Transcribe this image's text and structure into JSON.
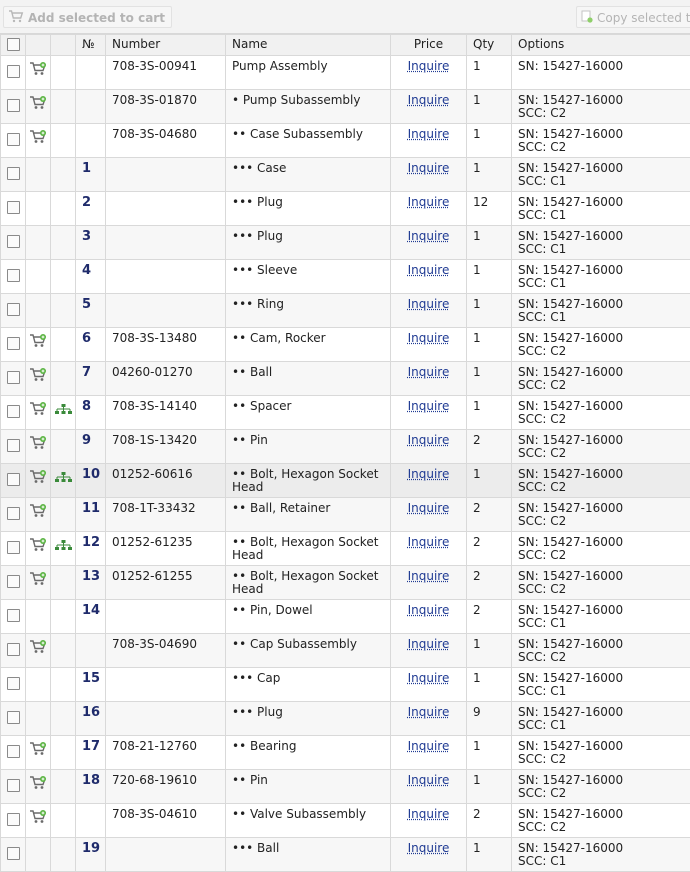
{
  "toolbar": {
    "add_selected_label": "Add selected to cart",
    "copy_selected_label": "Copy selected to"
  },
  "columns": {
    "no": "№",
    "number": "Number",
    "name": "Name",
    "price": "Price",
    "qty": "Qty",
    "options": "Options"
  },
  "rows": [
    {
      "cart": true,
      "tree": false,
      "no": "",
      "number": "708-3S-00941",
      "name": "Pump Assembly",
      "price": "Inquire",
      "qty": "1",
      "opt1": "SN: 15427-16000",
      "opt2": ""
    },
    {
      "cart": true,
      "tree": false,
      "no": "",
      "number": "708-3S-01870",
      "name": "• Pump Subassembly",
      "price": "Inquire",
      "qty": "1",
      "opt1": "SN: 15427-16000",
      "opt2": "SCC: C2"
    },
    {
      "cart": true,
      "tree": false,
      "no": "",
      "number": "708-3S-04680",
      "name": "•• Case Subassembly",
      "price": "Inquire",
      "qty": "1",
      "opt1": "SN: 15427-16000",
      "opt2": "SCC: C2"
    },
    {
      "cart": false,
      "tree": false,
      "no": "1",
      "number": "",
      "name": "••• Case",
      "price": "Inquire",
      "qty": "1",
      "opt1": "SN: 15427-16000",
      "opt2": "SCC: C1"
    },
    {
      "cart": false,
      "tree": false,
      "no": "2",
      "number": "",
      "name": "••• Plug",
      "price": "Inquire",
      "qty": "12",
      "opt1": "SN: 15427-16000",
      "opt2": "SCC: C1"
    },
    {
      "cart": false,
      "tree": false,
      "no": "3",
      "number": "",
      "name": "••• Plug",
      "price": "Inquire",
      "qty": "1",
      "opt1": "SN: 15427-16000",
      "opt2": "SCC: C1"
    },
    {
      "cart": false,
      "tree": false,
      "no": "4",
      "number": "",
      "name": "••• Sleeve",
      "price": "Inquire",
      "qty": "1",
      "opt1": "SN: 15427-16000",
      "opt2": "SCC: C1"
    },
    {
      "cart": false,
      "tree": false,
      "no": "5",
      "number": "",
      "name": "••• Ring",
      "price": "Inquire",
      "qty": "1",
      "opt1": "SN: 15427-16000",
      "opt2": "SCC: C1"
    },
    {
      "cart": true,
      "tree": false,
      "no": "6",
      "number": "708-3S-13480",
      "name": "•• Cam, Rocker",
      "price": "Inquire",
      "qty": "1",
      "opt1": "SN: 15427-16000",
      "opt2": "SCC: C2"
    },
    {
      "cart": true,
      "tree": false,
      "no": "7",
      "number": "04260-01270",
      "name": "•• Ball",
      "price": "Inquire",
      "qty": "1",
      "opt1": "SN: 15427-16000",
      "opt2": "SCC: C2"
    },
    {
      "cart": true,
      "tree": true,
      "no": "8",
      "number": "708-3S-14140",
      "name": "•• Spacer",
      "price": "Inquire",
      "qty": "1",
      "opt1": "SN: 15427-16000",
      "opt2": "SCC: C2"
    },
    {
      "cart": true,
      "tree": false,
      "no": "9",
      "number": "708-1S-13420",
      "name": "•• Pin",
      "price": "Inquire",
      "qty": "2",
      "opt1": "SN: 15427-16000",
      "opt2": "SCC: C2"
    },
    {
      "cart": true,
      "tree": true,
      "no": "10",
      "number": "01252-60616",
      "name": "•• Bolt, Hexagon Socket Head",
      "price": "Inquire",
      "qty": "1",
      "opt1": "SN: 15427-16000",
      "opt2": "SCC: C2",
      "highlight": true
    },
    {
      "cart": true,
      "tree": false,
      "no": "11",
      "number": "708-1T-33432",
      "name": "•• Ball, Retainer",
      "price": "Inquire",
      "qty": "2",
      "opt1": "SN: 15427-16000",
      "opt2": "SCC: C2"
    },
    {
      "cart": true,
      "tree": true,
      "no": "12",
      "number": "01252-61235",
      "name": "•• Bolt, Hexagon Socket Head",
      "price": "Inquire",
      "qty": "2",
      "opt1": "SN: 15427-16000",
      "opt2": "SCC: C2"
    },
    {
      "cart": true,
      "tree": false,
      "no": "13",
      "number": "01252-61255",
      "name": "•• Bolt, Hexagon Socket Head",
      "price": "Inquire",
      "qty": "2",
      "opt1": "SN: 15427-16000",
      "opt2": "SCC: C2"
    },
    {
      "cart": false,
      "tree": false,
      "no": "14",
      "number": "",
      "name": "•• Pin, Dowel",
      "price": "Inquire",
      "qty": "2",
      "opt1": "SN: 15427-16000",
      "opt2": "SCC: C1"
    },
    {
      "cart": true,
      "tree": false,
      "no": "",
      "number": "708-3S-04690",
      "name": "•• Cap Subassembly",
      "price": "Inquire",
      "qty": "1",
      "opt1": "SN: 15427-16000",
      "opt2": "SCC: C2"
    },
    {
      "cart": false,
      "tree": false,
      "no": "15",
      "number": "",
      "name": "••• Cap",
      "price": "Inquire",
      "qty": "1",
      "opt1": "SN: 15427-16000",
      "opt2": "SCC: C1"
    },
    {
      "cart": false,
      "tree": false,
      "no": "16",
      "number": "",
      "name": "••• Plug",
      "price": "Inquire",
      "qty": "9",
      "opt1": "SN: 15427-16000",
      "opt2": "SCC: C1"
    },
    {
      "cart": true,
      "tree": false,
      "no": "17",
      "number": "708-21-12760",
      "name": "•• Bearing",
      "price": "Inquire",
      "qty": "1",
      "opt1": "SN: 15427-16000",
      "opt2": "SCC: C2"
    },
    {
      "cart": true,
      "tree": false,
      "no": "18",
      "number": "720-68-19610",
      "name": "•• Pin",
      "price": "Inquire",
      "qty": "1",
      "opt1": "SN: 15427-16000",
      "opt2": "SCC: C2"
    },
    {
      "cart": true,
      "tree": false,
      "no": "",
      "number": "708-3S-04610",
      "name": "•• Valve Subassembly",
      "price": "Inquire",
      "qty": "2",
      "opt1": "SN: 15427-16000",
      "opt2": "SCC: C2"
    },
    {
      "cart": false,
      "tree": false,
      "no": "19",
      "number": "",
      "name": "••• Ball",
      "price": "Inquire",
      "qty": "1",
      "opt1": "SN: 15427-16000",
      "opt2": "SCC: C1"
    }
  ]
}
